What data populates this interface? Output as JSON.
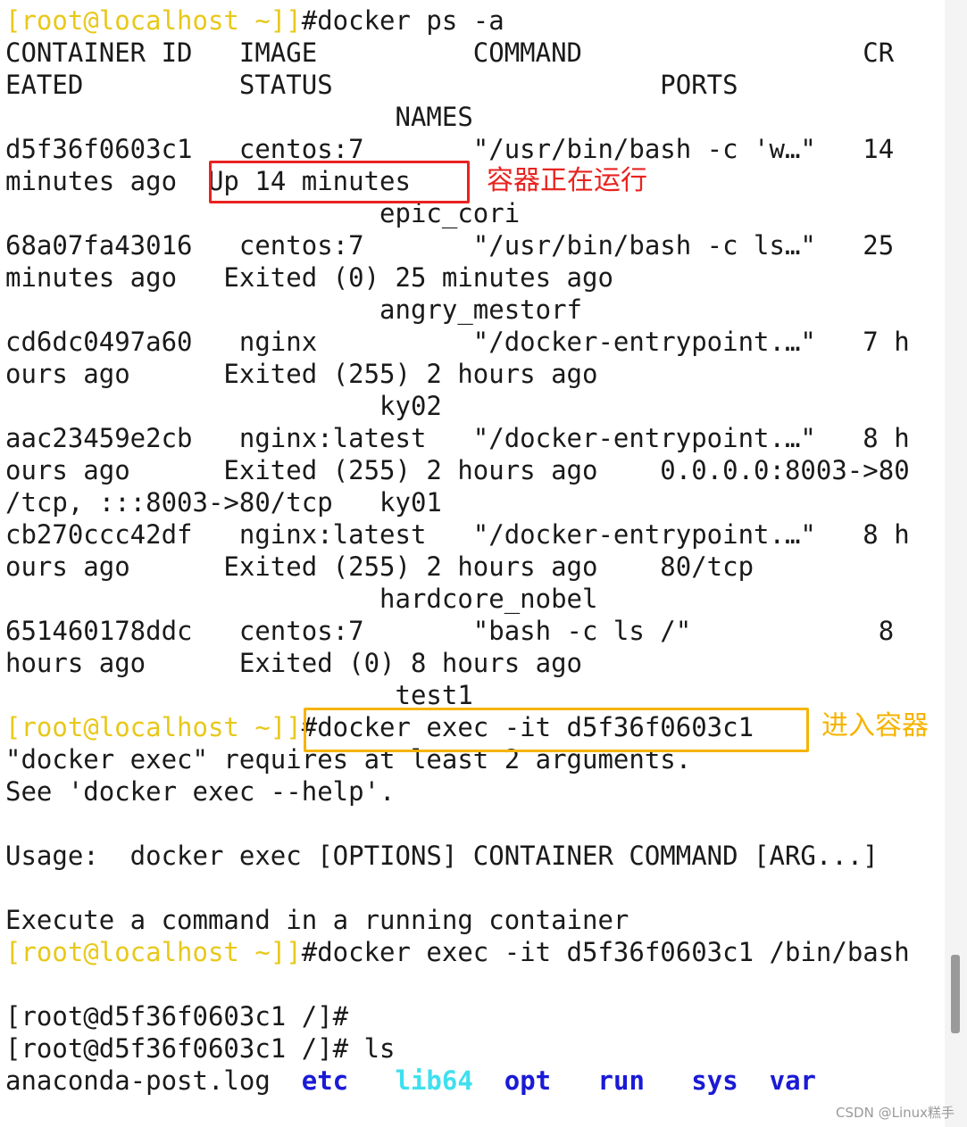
{
  "terminal": {
    "prompt_host": "[root@localhost ~]]",
    "cmd_ps": "#docker ps -a",
    "header1": "CONTAINER ID   IMAGE          COMMAND                  CR",
    "header2": "EATED          STATUS                     PORTS",
    "header3": "                         NAMES",
    "rows": [
      {
        "l1": "d5f36f0603c1   centos:7       \"/usr/bin/bash -c 'w…\"   14",
        "l2_a": "minutes ago ",
        "l2_b": " Up 14 minutes",
        "l3": "                        epic_cori"
      },
      {
        "l1": "68a07fa43016   centos:7       \"/usr/bin/bash -c ls…\"   25",
        "l2": "minutes ago   Exited (0) 25 minutes ago",
        "l3": "                        angry_mestorf"
      },
      {
        "l1": "cd6dc0497a60   nginx          \"/docker-entrypoint.…\"   7 h",
        "l2": "ours ago      Exited (255) 2 hours ago",
        "l3": "                        ky02"
      },
      {
        "l1": "aac23459e2cb   nginx:latest   \"/docker-entrypoint.…\"   8 h",
        "l2": "ours ago      Exited (255) 2 hours ago    0.0.0.0:8003->80",
        "l3": "/tcp, :::8003->80/tcp   ky01"
      },
      {
        "l1": "cb270ccc42df   nginx:latest   \"/docker-entrypoint.…\"   8 h",
        "l2": "ours ago      Exited (255) 2 hours ago    80/tcp",
        "l3": "                        hardcore_nobel"
      },
      {
        "l1": "651460178ddc   centos:7       \"bash -c ls /\"            8",
        "l2": "hours ago      Exited (0) 8 hours ago",
        "l3": "                         test1"
      }
    ],
    "cmd_exec1": "#docker exec -it d5f36f0603c1",
    "err1": "\"docker exec\" requires at least 2 arguments.",
    "err2": "See 'docker exec --help'.",
    "usage": "Usage:  docker exec [OPTIONS] CONTAINER COMMAND [ARG...]",
    "execute": "Execute a command in a running container",
    "cmd_exec2": "#docker exec -it d5f36f0603c1 /bin/bash",
    "container_prompt1": "[root@d5f36f0603c1 /]#",
    "container_prompt2": "[root@d5f36f0603c1 /]# ls",
    "ls_file": "anaconda-post.log",
    "ls_dirs": {
      "etc": "etc",
      "lib64": "lib64",
      "opt": "opt",
      "run": "run",
      "sys": "sys",
      "var": "var"
    }
  },
  "annotations": {
    "running": "容器正在运行",
    "enter": "进入容器"
  },
  "watermark": "CSDN @Linux糕手",
  "colors": {
    "prompt": "#e8c81a",
    "red": "#e8231f",
    "orange": "#f5b400",
    "dir": "#1a1ad6",
    "link": "#3ee0ee"
  }
}
